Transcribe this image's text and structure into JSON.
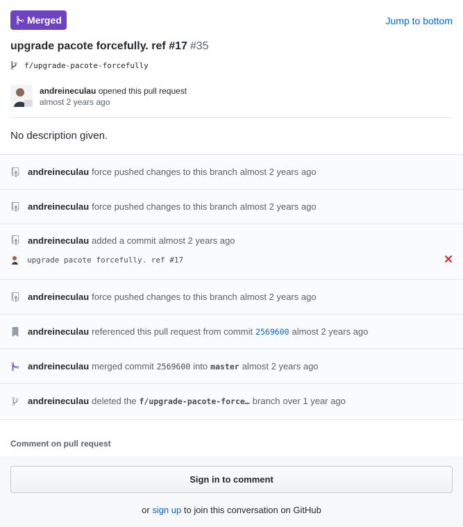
{
  "header": {
    "badge_label": "Merged",
    "jump_label": "Jump to bottom",
    "title": "upgrade pacote forcefully. ref #17",
    "number": "#35",
    "branch": "f/upgrade-pacote-forcefully",
    "author": "andreineculau",
    "opened_text": "opened this pull request",
    "opened_time": "almost 2 years ago",
    "description": "No description given."
  },
  "events": [
    {
      "user": "andreineculau",
      "text": "force pushed changes to this branch",
      "time": "almost 2 years ago",
      "icon": "repo-push-icon"
    },
    {
      "user": "andreineculau",
      "text": "force pushed changes to this branch",
      "time": "almost 2 years ago",
      "icon": "repo-push-icon"
    },
    {
      "user": "andreineculau",
      "text": "added a commit",
      "time": "almost 2 years ago",
      "icon": "repo-push-icon",
      "commit_message": "upgrade pacote forcefully. ref #17",
      "status_icon": "x-icon"
    },
    {
      "user": "andreineculau",
      "text": "force pushed changes to this branch",
      "time": "almost 2 years ago",
      "icon": "repo-push-icon"
    },
    {
      "user": "andreineculau",
      "text": "referenced this pull request from commit",
      "sha": "2569600",
      "time": "almost 2 years ago",
      "icon": "bookmark-icon"
    },
    {
      "user": "andreineculau",
      "text": "merged commit",
      "sha": "2569600",
      "into": "into",
      "target": "master",
      "time": "almost 2 years ago",
      "icon": "git-merge-icon"
    },
    {
      "user": "andreineculau",
      "text": "deleted the",
      "branch": "f/upgrade-pacote-force…",
      "branch_word": "branch",
      "time": "over 1 year ago",
      "icon": "git-branch-icon"
    }
  ],
  "comment": {
    "label": "Comment on pull request",
    "signin_label": "Sign in to comment",
    "or_text": "or",
    "signup_label": "sign up",
    "join_text": "to join this conversation on GitHub"
  },
  "colors": {
    "merged": "#6f42c1",
    "link": "#0366d6",
    "error": "#cb2431"
  }
}
